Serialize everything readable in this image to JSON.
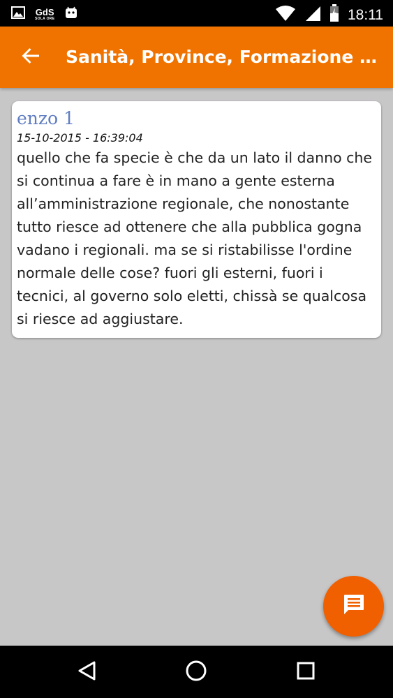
{
  "status_bar": {
    "time": "18:11",
    "icons": [
      "image-icon",
      "gds-app-icon",
      "android-icon",
      "wifi-icon",
      "signal-icon",
      "battery-icon"
    ],
    "gds_logo_text": "GdS",
    "gds_logo_subtext": "SOLA ORE"
  },
  "app_bar": {
    "title": "Sanità, Province, Formazione e dirigenti regionali",
    "back_icon": "arrow-back-icon",
    "background_color": "#f07300"
  },
  "comments": [
    {
      "author": "enzo 1",
      "date": "15-10-2015 - 16:39:04",
      "text": "quello che fa specie è che da un lato il danno che si continua a fare è in mano a gente esterna all’amministrazione regionale, che nonostante tutto riesce ad ottenere che alla pubblica gogna vadano i regionali. ma se si ristabilisse l'ordine normale delle cose? fuori gli esterni, fuori i tecnici, al governo solo eletti, chissà se qualcosa si riesce ad aggiustare."
    }
  ],
  "fab": {
    "icon": "comment-icon",
    "color": "#f06000"
  },
  "nav_bar": {
    "buttons": [
      "back-triangle-icon",
      "home-circle-icon",
      "recents-square-icon"
    ]
  },
  "colors": {
    "page_background": "#c8c7c8",
    "author_color": "#5f7dc2"
  }
}
